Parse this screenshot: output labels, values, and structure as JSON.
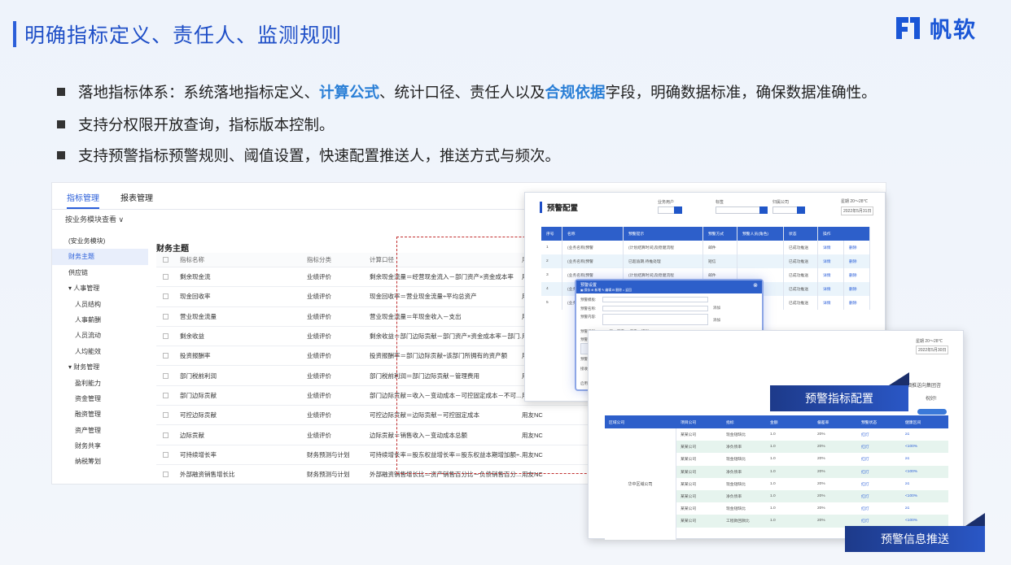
{
  "header": {
    "title": "明确指标定义、责任人、监测规则",
    "logo_text": "帆软",
    "logo_icon": "fanruan-logo-icon",
    "accent": "#1f4fc7"
  },
  "bullets": [
    {
      "pre": "落地指标体系：系统落地指标定义、",
      "hl1": "计算公式",
      "mid": "、统计口径、责任人以及",
      "hl2": "合规依据",
      "post": "字段，明确数据标准，确保数据准确性。"
    },
    {
      "text": "支持分权限开放查询，指标版本控制。"
    },
    {
      "text": "支持预警指标预警规则、阈值设置，快速配置推送人，推送方式与频次。"
    }
  ],
  "app": {
    "tabs": [
      "指标管理",
      "报表管理"
    ],
    "view_select": "按业务模块查看 ∨",
    "sidebar": [
      "(安业务模块)",
      "财务主题",
      "供应链",
      "▾ 人事管理",
      "人员结构",
      "人事薪酬",
      "人员流动",
      "人均能效",
      "▾ 财务管理",
      "盈利能力",
      "资金管理",
      "融资管理",
      "资产管理",
      "财务共享",
      "纳税筹划"
    ],
    "section_title": "财务主题",
    "table_headers": [
      "指标名称",
      "指标分类",
      "计算口径",
      "用"
    ],
    "rows": [
      [
        "剩余现金流",
        "业绩评价",
        "剩余现金流量＝经营现金流入－部门资产×资金成本率",
        "用"
      ],
      [
        "现金回收率",
        "业绩评价",
        "现金回收率＝营业现金流量÷平均总资产",
        "用"
      ],
      [
        "营业现金流量",
        "业绩评价",
        "营业现金流量＝年现金收入－支出",
        "用"
      ],
      [
        "剩余收益",
        "业绩评价",
        "剩余收益＝部门边际贡献－部门资产×资金成本率－部门...",
        "用"
      ],
      [
        "投资报酬率",
        "业绩评价",
        "投资报酬率＝部门边际贡献÷该部门所拥有的资产额",
        "用"
      ],
      [
        "部门税前利润",
        "业绩评价",
        "部门税前利润＝部门边际贡献－管理费用",
        "用"
      ],
      [
        "部门边际贡献",
        "业绩评价",
        "部门边际贡献＝收入－变动成本－可控固定成本－不可...",
        "用"
      ],
      [
        "可控边际贡献",
        "业绩评价",
        "可控边际贡献＝边际贡献－可控固定成本",
        "用友NC"
      ],
      [
        "边际贡献",
        "业绩评价",
        "边际贡献＝销售收入－变动成本总额",
        "用友NC"
      ],
      [
        "可持续增长率",
        "财务预测与计划",
        "可持续增长率＝股东权益增长率＝股东权益本期增加额÷...",
        "用友NC"
      ],
      [
        "外部融资销售增长比",
        "财务预测与计划",
        "外部融资销售增长比＝资产销售百分比－负债销售百分...",
        "用友NC"
      ]
    ]
  },
  "config": {
    "title": "预警配置",
    "filters": [
      "业务用户",
      "标签",
      "归属公司"
    ],
    "date_note": "星期  20～28℃",
    "date": "2022年5月31日",
    "headers": [
      "序号",
      "名称",
      "预警提示",
      "预警方式",
      "预警人员(角色)",
      "状态",
      "操作",
      ""
    ],
    "rows": [
      [
        "1",
        "(业务名称)预警",
        "(计划结算时间)及稳健流程",
        "邮件",
        "",
        "已成功推送",
        "详情",
        "删除"
      ],
      [
        "2",
        "(业务名称)预警",
        "已超逾期,待推处理",
        "短信",
        "",
        "已成功推送",
        "详情",
        "删除"
      ],
      [
        "3",
        "(业务名称)预警",
        "(计划结算时间)及稳健流程",
        "邮件",
        "",
        "已成功推送",
        "详情",
        "删除"
      ],
      [
        "4",
        "(业务名称)预警",
        "已超逾期,待推处理",
        "短信",
        "",
        "已成功推送",
        "详情",
        "删除"
      ],
      [
        "5",
        "(业务名称)预警",
        "(计划结算时间)及稳健流程",
        "邮件",
        "",
        "已成功推送",
        "详情",
        "删除"
      ]
    ],
    "dialog": {
      "title": "预警设置",
      "toolbar": "▣ 保存  ⊕ 新增  ✎ 编辑  ⊟ 删除  ⌂ 返回",
      "labels": [
        "预警模板:",
        "预警名称:",
        "预警内容:",
        "预警级别:",
        "预警规则:",
        "预警对象:",
        "接收组:",
        "启用:"
      ],
      "add": "添加",
      "levels": "○ 一般  ○ 较重  ◉ 严重  ○ 特别",
      "enable": "◉ 启用  ○ 禁用"
    },
    "banner": "预警指标配置"
  },
  "push": {
    "date_note": "星期  20～28℃",
    "date": "2022年5月30日",
    "notice": "...明细推送向集团咨",
    "greeting": "祝好!",
    "headers": [
      "区域公司",
      "项目公司",
      "指标",
      "金额",
      "偏差率",
      "预警状态",
      "健康区间"
    ],
    "group": "华中区域公司",
    "rows": [
      [
        "某某公司",
        "现金短缺比",
        "1.0",
        "20%",
        "红灯",
        "≥1"
      ],
      [
        "某某公司",
        "净负债率",
        "1.0",
        "20%",
        "红灯",
        "<100%"
      ],
      [
        "某某公司",
        "现金短缺比",
        "1.0",
        "20%",
        "红灯",
        "≥1"
      ],
      [
        "某某公司",
        "净负债率",
        "1.0",
        "20%",
        "红灯",
        "<100%"
      ],
      [
        "某某公司",
        "现金短缺比",
        "1.0",
        "20%",
        "红灯",
        "≥1"
      ],
      [
        "某某公司",
        "净负债率",
        "1.0",
        "20%",
        "红灯",
        "<100%"
      ],
      [
        "某某公司",
        "现金短缺比",
        "1.0",
        "20%",
        "红灯",
        "≥1"
      ],
      [
        "某某公司",
        "工程款回款比",
        "1.0",
        "20%",
        "红灯",
        "<100%"
      ]
    ],
    "banner": "预警信息推送"
  }
}
